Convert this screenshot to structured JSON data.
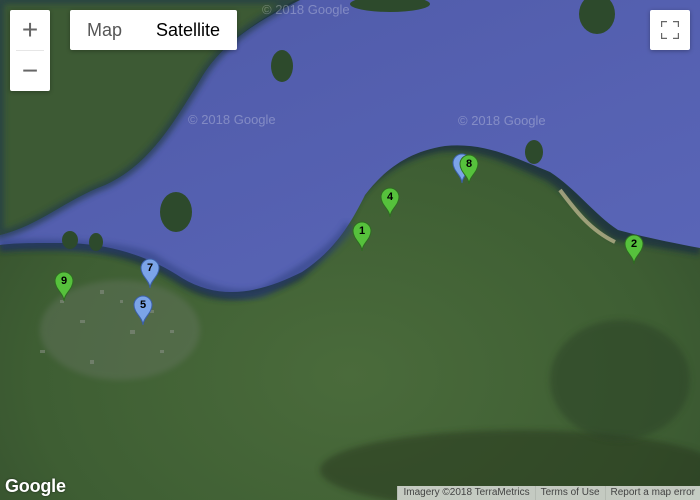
{
  "controls": {
    "zoom_in": "+",
    "zoom_out": "−",
    "map_type": [
      {
        "label": "Map",
        "active": false
      },
      {
        "label": "Satellite",
        "active": true
      }
    ]
  },
  "watermark": "© 2018 Google",
  "markers": [
    {
      "label": "1",
      "color": "#56c13c"
    },
    {
      "label": "2",
      "color": "#56c13c"
    },
    {
      "label": "4",
      "color": "#56c13c"
    },
    {
      "label": "5",
      "color": "#7ba4e8"
    },
    {
      "label": "7",
      "color": "#7ba4e8"
    },
    {
      "label": "8",
      "color": "#56c13c"
    },
    {
      "label": "9",
      "color": "#56c13c"
    },
    {
      "label": "",
      "color": "#7ba4e8"
    }
  ],
  "branding": {
    "logo": "Google"
  },
  "attribution": {
    "imagery": "Imagery ©2018 TerraMetrics",
    "terms": "Terms of Use",
    "report": "Report a map error"
  }
}
